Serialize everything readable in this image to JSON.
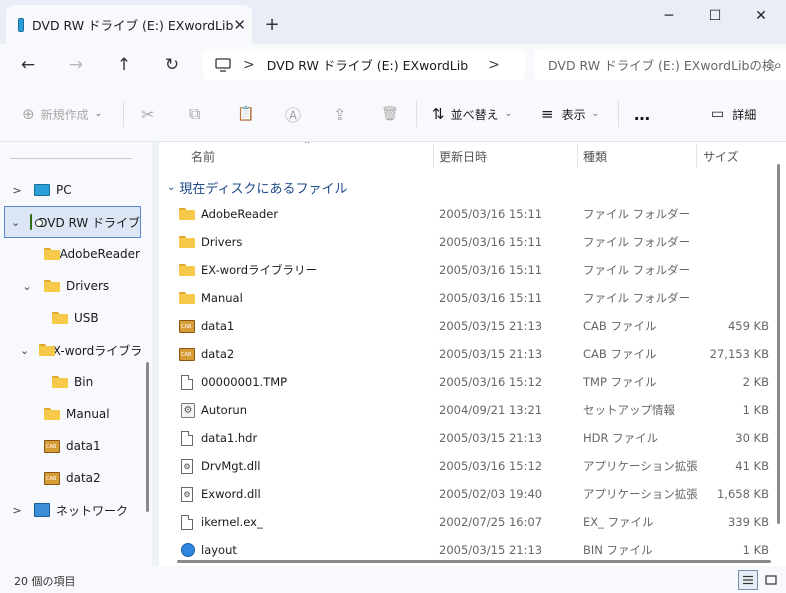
{
  "window": {
    "tab_title": "DVD RW ドライブ (E:) EXwordLib",
    "tab_close": "✕",
    "new_tab": "+",
    "minimize": "─",
    "maximize": "☐",
    "close": "✕"
  },
  "nav": {
    "back": "←",
    "forward": "→",
    "up": "↑",
    "refresh": "↻",
    "address_sep": ">",
    "address_text": "DVD RW ドライブ (E:) EXwordLib",
    "address_more": ">",
    "search_placeholder": "DVD RW ドライブ (E:) EXwordLibの検索",
    "search_icon": "⌕"
  },
  "commands": {
    "new_label": "新規作成",
    "new_icon": "⊕",
    "cut_icon": "✂",
    "copy_icon": "⧉",
    "paste_icon": "📋",
    "rename_icon": "Ⓐ",
    "share_icon": "⇪",
    "delete_icon": "🗑",
    "sort_label": "並べ替え",
    "sort_icon": "⇅",
    "view_label": "表示",
    "view_icon": "≡",
    "more_label": "…",
    "details_label": "詳細",
    "details_icon": "▭",
    "caret": "⌄"
  },
  "sidebar": {
    "items": [
      {
        "label": "PC",
        "chevron": ">"
      },
      {
        "label": "DVD RW ドライブ",
        "chevron": "⌄"
      },
      {
        "label": "AdobeReader",
        "chevron": ""
      },
      {
        "label": "Drivers",
        "chevron": "⌄"
      },
      {
        "label": "USB",
        "chevron": ""
      },
      {
        "label": "EX-wordライブラ",
        "chevron": "⌄"
      },
      {
        "label": "Bin",
        "chevron": ""
      },
      {
        "label": "Manual",
        "chevron": ""
      },
      {
        "label": "data1",
        "chevron": ""
      },
      {
        "label": "data2",
        "chevron": ""
      },
      {
        "label": "ネットワーク",
        "chevron": ">"
      }
    ]
  },
  "table": {
    "headers": {
      "name": "名前",
      "date": "更新日時",
      "type": "種類",
      "size": "サイズ"
    },
    "sort_arrow": "⌃",
    "group_label": "現在ディスクにあるファイル",
    "group_chevron": "⌄",
    "rows": [
      {
        "name": "AdobeReader",
        "date": "2005/03/16 15:11",
        "type": "ファイル フォルダー",
        "size": "",
        "icon": "folder"
      },
      {
        "name": "Drivers",
        "date": "2005/03/16 15:11",
        "type": "ファイル フォルダー",
        "size": "",
        "icon": "folder"
      },
      {
        "name": "EX-wordライブラリー",
        "date": "2005/03/16 15:11",
        "type": "ファイル フォルダー",
        "size": "",
        "icon": "folder"
      },
      {
        "name": "Manual",
        "date": "2005/03/16 15:11",
        "type": "ファイル フォルダー",
        "size": "",
        "icon": "folder"
      },
      {
        "name": "data1",
        "date": "2005/03/15 21:13",
        "type": "CAB ファイル",
        "size": "459 KB",
        "icon": "cab"
      },
      {
        "name": "data2",
        "date": "2005/03/15 21:13",
        "type": "CAB ファイル",
        "size": "27,153 KB",
        "icon": "cab"
      },
      {
        "name": "00000001.TMP",
        "date": "2005/03/16 15:12",
        "type": "TMP ファイル",
        "size": "2 KB",
        "icon": "doc"
      },
      {
        "name": "Autorun",
        "date": "2004/09/21 13:21",
        "type": "セットアップ情報",
        "size": "1 KB",
        "icon": "gear-doc"
      },
      {
        "name": "data1.hdr",
        "date": "2005/03/15 21:13",
        "type": "HDR ファイル",
        "size": "30 KB",
        "icon": "doc"
      },
      {
        "name": "DrvMgt.dll",
        "date": "2005/03/16 15:12",
        "type": "アプリケーション拡張",
        "size": "41 KB",
        "icon": "dll"
      },
      {
        "name": "Exword.dll",
        "date": "2005/02/03 19:40",
        "type": "アプリケーション拡張",
        "size": "1,658 KB",
        "icon": "dll"
      },
      {
        "name": "ikernel.ex_",
        "date": "2002/07/25 16:07",
        "type": "EX_ ファイル",
        "size": "339 KB",
        "icon": "doc"
      },
      {
        "name": "layout",
        "date": "2005/03/15 21:13",
        "type": "BIN ファイル",
        "size": "1 KB",
        "icon": "bin"
      }
    ]
  },
  "status": {
    "item_count": "20 個の項目"
  }
}
